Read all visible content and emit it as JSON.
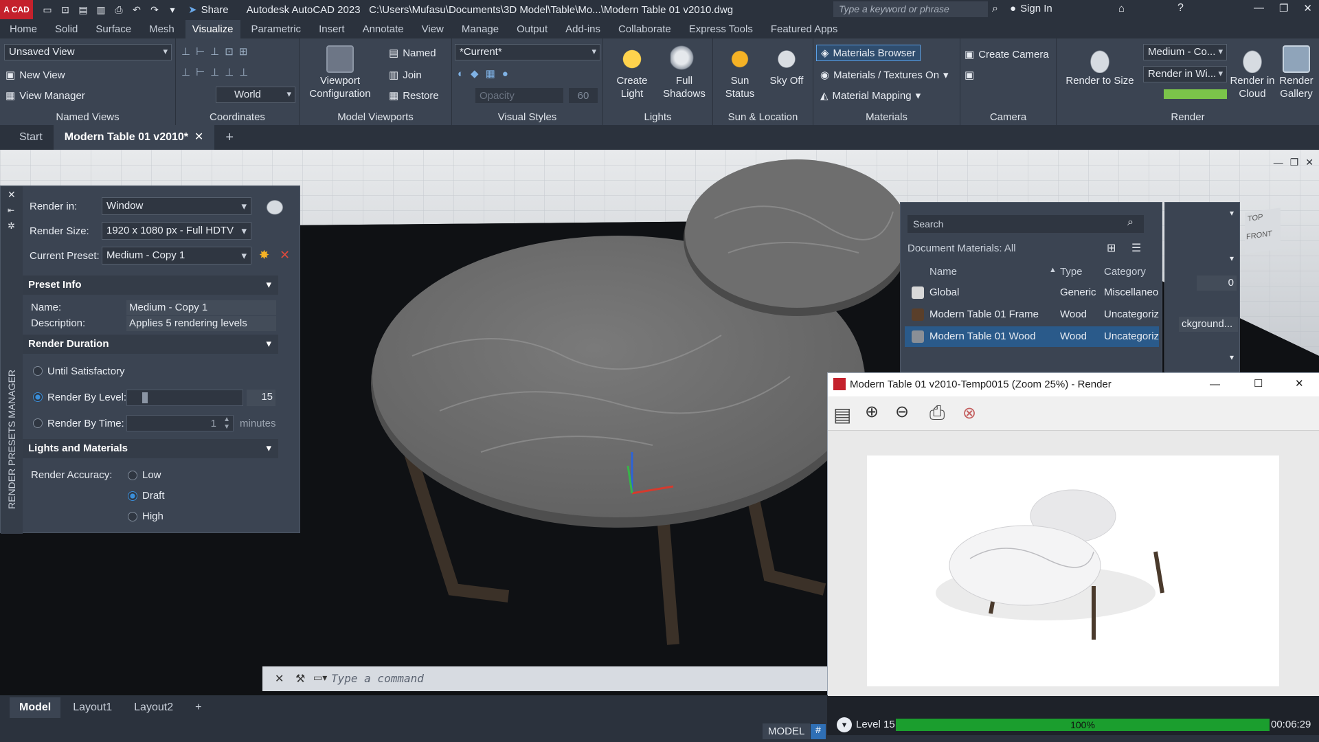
{
  "titlebar": {
    "logo": "A CAD",
    "share_label": "Share",
    "title": "Autodesk AutoCAD 2023",
    "path": "C:\\Users\\Mufasu\\Documents\\3D Model\\Table\\Mo...\\Modern Table 01 v2010.dwg",
    "search_placeholder": "Type a keyword or phrase",
    "signin_label": "Sign In"
  },
  "ribbon_tabs": [
    "Home",
    "Solid",
    "Surface",
    "Mesh",
    "Visualize",
    "Parametric",
    "Insert",
    "Annotate",
    "View",
    "Manage",
    "Output",
    "Add-ins",
    "Collaborate",
    "Express Tools",
    "Featured Apps"
  ],
  "active_ribbon_tab": "Visualize",
  "ribbon": {
    "named_views": {
      "combo": "Unsaved View",
      "new_view": "New View",
      "view_manager": "View Manager",
      "label": "Named Views"
    },
    "coordinates": {
      "ucs_combo": "World",
      "label": "Coordinates"
    },
    "model_viewports": {
      "config_label_1": "Viewport",
      "config_label_2": "Configuration",
      "named": "Named",
      "join": "Join",
      "restore": "Restore",
      "label": "Model Viewports"
    },
    "visual_styles": {
      "combo": "*Current*",
      "opacity_placeholder": "Opacity",
      "opacity_value": "60",
      "label": "Visual Styles"
    },
    "lights": {
      "create_1": "Create",
      "create_2": "Light",
      "shadows_1": "Full",
      "shadows_2": "Shadows",
      "label": "Lights"
    },
    "sun": {
      "status_1": "Sun",
      "status_2": "Status",
      "sky": "Sky Off",
      "label": "Sun & Location"
    },
    "materials": {
      "browser": "Materials Browser",
      "textures": "Materials / Textures On",
      "mapping": "Material Mapping",
      "label": "Materials"
    },
    "camera": {
      "create": "Create Camera",
      "label": "Camera"
    },
    "render": {
      "size_1": "Render to Size",
      "preset_combo": "Medium - Co...",
      "render_in_combo": "Render in Wi...",
      "cloud_1": "Render in",
      "cloud_2": "Cloud",
      "gallery_1": "Render",
      "gallery_2": "Gallery",
      "label": "Render"
    }
  },
  "doc_tabs": {
    "start": "Start",
    "active": "Modern Table 01 v2010*"
  },
  "render_presets": {
    "side_title": "RENDER PRESETS MANAGER",
    "render_in_label": "Render in:",
    "render_in_value": "Window",
    "render_size_label": "Render Size:",
    "render_size_value": "1920 x 1080 px - Full HDTV",
    "current_preset_label": "Current Preset:",
    "current_preset_value": "Medium - Copy 1",
    "preset_info_header": "Preset Info",
    "name_label": "Name:",
    "name_value": "Medium - Copy 1",
    "desc_label": "Description:",
    "desc_value": "Applies 5 rendering levels",
    "duration_header": "Render Duration",
    "until_satisfactory": "Until Satisfactory",
    "by_level": "Render By Level:",
    "level_value": "15",
    "by_time": "Render By Time:",
    "time_value": "1",
    "time_unit": "minutes",
    "lights_header": "Lights and Materials",
    "accuracy_label": "Render Accuracy:",
    "acc_low": "Low",
    "acc_draft": "Draft",
    "acc_high": "High",
    "selected_accuracy": "Draft"
  },
  "materials_browser": {
    "search_placeholder": "Search",
    "header": "Document Materials: All",
    "columns": {
      "name": "Name",
      "type": "Type",
      "category": "Category"
    },
    "rows": [
      {
        "name": "Global",
        "type": "Generic",
        "category": "Miscellaneous",
        "swatch": "#d8d8d8"
      },
      {
        "name": "Modern Table 01 Frame",
        "type": "Wood",
        "category": "Uncategorized",
        "swatch": "#5a3f2a"
      },
      {
        "name": "Modern Table 01 Wood",
        "type": "Wood",
        "category": "Uncategorized",
        "swatch": "#8a8f96"
      }
    ]
  },
  "right_dock": {
    "value": "0",
    "background_btn": "ckground...",
    "viewcube_top": "TOP",
    "viewcube_front": "FRONT"
  },
  "render_window": {
    "title": "Modern Table 01 v2010-Temp0015 (Zoom 25%) - Render",
    "level_label": "Level 15",
    "progress_text": "100%",
    "progress_fraction": 1.0,
    "elapsed": "00:06:29"
  },
  "command_line": {
    "placeholder": "Type a command"
  },
  "layout_tabs": [
    "Model",
    "Layout1",
    "Layout2"
  ],
  "status": {
    "model": "MODEL"
  },
  "colors": {
    "accent": "#3a8ed9",
    "progress": "#1b9e2e",
    "logo": "#c4212c"
  }
}
